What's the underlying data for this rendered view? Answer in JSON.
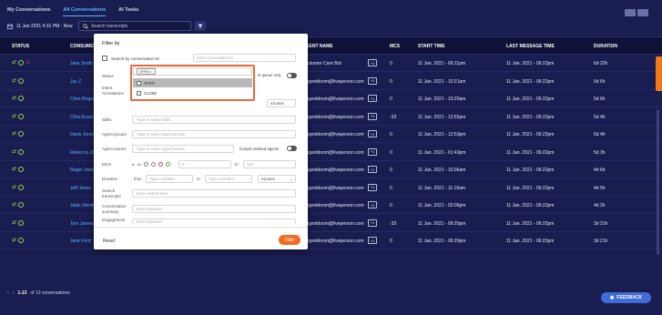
{
  "tabs": [
    "My Conversations",
    "All Conversations",
    "AI Tasks"
  ],
  "date_range": "11 Jan 2021 4:31 PM - Now",
  "search": {
    "placeholder": "Search transcripts"
  },
  "columns": [
    "STATUS",
    "CONSUMER",
    "AGENT NAME",
    "MCS",
    "START TIME",
    "LAST MESSAGE TIME",
    "DURATION"
  ],
  "rows": [
    {
      "consumer": "Jake Smith",
      "agent": "Customer Care Bot",
      "mcs": "0",
      "start": "11 Jan. 2021 - 06:11pm",
      "last": "11 Jan. 2021 - 06:22pm",
      "duration": "6d 22h",
      "alert": true
    },
    {
      "consumer": "Joy Z",
      "agent": "rfaigenbloom@liveperson.com",
      "mcs": "0",
      "start": "11 Jan. 2021 - 10:21am",
      "last": "11 Jan. 2021 - 06:22pm",
      "duration": "5d 6h",
      "alert": false
    },
    {
      "consumer": "Chris Rogers",
      "agent": "rfaigenbloom@liveperson.com",
      "mcs": "0",
      "start": "11 Jan. 2021 - 10:20am",
      "last": "11 Jan. 2021 - 06:22pm",
      "duration": "5d 6h",
      "alert": false
    },
    {
      "consumer": "Chris Evans",
      "agent": "rfaigenbloom@liveperson.com",
      "mcs": "-33",
      "start": "11 Jan. 2021 - 12:55pm",
      "last": "11 Jan. 2021 - 06:22pm",
      "duration": "5d 4h",
      "alert": false
    },
    {
      "consumer": "Davis Jones",
      "agent": "rfaigenbloom@liveperson.com",
      "mcs": "0",
      "start": "11 Jan. 2021 - 12:53pm",
      "last": "11 Jan. 2021 - 06:22pm",
      "duration": "5d 4h",
      "alert": false
    },
    {
      "consumer": "Rebecca Jones",
      "agent": "rfaigenbloom@liveperson.com",
      "mcs": "0",
      "start": "11 Jan. 2021 - 01:43pm",
      "last": "11 Jan. 2021 - 06:22pm",
      "duration": "5d 3h",
      "alert": false
    },
    {
      "consumer": "Roger Jones",
      "agent": "rfaigenbloom@liveperson.com",
      "mcs": "0",
      "start": "11 Jan. 2021 - 10:36am",
      "last": "11 Jan. 2021 - 06:22pm",
      "duration": "4d 6h",
      "alert": false
    },
    {
      "consumer": "Jeff Jones",
      "agent": "rfaigenbloom@liveperson.com",
      "mcs": "0",
      "start": "11 Jan. 2021 - 11:19am",
      "last": "11 Jan. 2021 - 06:22pm",
      "duration": "4d 5h",
      "alert": false
    },
    {
      "consumer": "Jade christian",
      "agent": "rfaigenbloom@liveperson.com",
      "mcs": "0",
      "start": "11 Jan. 2021 - 02:06pm",
      "last": "11 Jan. 2021 - 06:22pm",
      "duration": "4d 2h",
      "alert": false
    },
    {
      "consumer": "Tom James",
      "agent": "rfaigenbloom@liveperson.com",
      "mcs": "-33",
      "start": "11 Jan. 2021 - 06:20pm",
      "last": "11 Jan. 2021 - 06:22pm",
      "duration": "3d 21h",
      "alert": false,
      "human": "Human"
    },
    {
      "consumer": "Jane Ford",
      "agent": "rfaigenbloom@liveperson.com",
      "mcs": "0",
      "start": "11 Jan. 2021 - 06:20pm",
      "last": "11 Jan. 2021 - 06:22pm",
      "duration": "3d 21h",
      "alert": false,
      "human": "Human"
    }
  ],
  "footer": {
    "range": "1-13",
    "of": "of 13 conversations"
  },
  "feedback": "FEEDBACK",
  "modal": {
    "title": "Filter by",
    "search_by_id": "Search by conversation ID",
    "id_placeholder": "Enter conversation ID",
    "status_label": "Status",
    "status_chip": "OPEN ×",
    "status_options": [
      "OPEN",
      "CLOSE"
    ],
    "queue_only": "in queue only",
    "intent_label": "Intent Annotations",
    "minutes": "minutes",
    "skills_label": "Skills",
    "skills_placeholder": "Type or select skills",
    "agent_groups_label": "Agent groups",
    "agent_groups_placeholder": "Type or select agent groups",
    "agent_names_label": "Agent names",
    "agent_names_placeholder": "Type or select agent names",
    "include_deleted": "Include deleted agents",
    "mcs_label": "MCS",
    "mcs_all": "All",
    "mcs_from": "0",
    "mcs_to_label": "to",
    "mcs_to": "100",
    "duration_label": "Duration",
    "from_label": "from",
    "to_label": "to",
    "type_number": "Type a number",
    "search_transcripts_label": "Search transcripts",
    "search_term": "Enter search term",
    "summary_label": "Conversation summary",
    "keyword": "Enter keyword",
    "engagement_label": "Engagement",
    "reset": "Reset",
    "filter": "Filter"
  }
}
